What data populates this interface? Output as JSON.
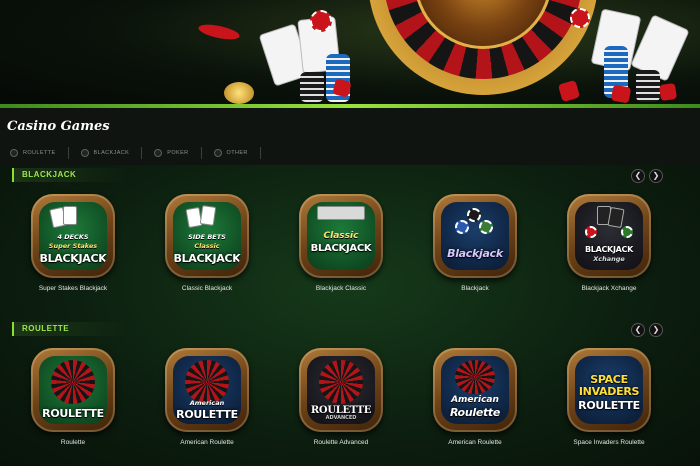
{
  "page": {
    "title": "Casino Games"
  },
  "filters": [
    {
      "label": "ROULETTE"
    },
    {
      "label": "BLACKJACK"
    },
    {
      "label": "POKER"
    },
    {
      "label": "OTHER"
    }
  ],
  "sections": [
    {
      "title": "BLACKJACK",
      "prev_icon": "chevron-left-icon",
      "next_icon": "chevron-right-icon",
      "games": [
        {
          "name": "Super Stakes Blackjack",
          "logo_top": "4 DECKS",
          "logo_mid": "Super Stakes",
          "logo_big": "BLACKJACK",
          "theme": "felt"
        },
        {
          "name": "Classic Blackjack",
          "logo_top": "SIDE BETS",
          "logo_mid": "Classic",
          "logo_big": "BLACKJACK",
          "theme": "felt"
        },
        {
          "name": "Blackjack Classic",
          "logo_top": "",
          "logo_mid": "Classic",
          "logo_big": "BLACKJACK",
          "theme": "felt"
        },
        {
          "name": "Blackjack",
          "logo_top": "",
          "logo_mid": "",
          "logo_big": "Blackjack",
          "theme": "blue"
        },
        {
          "name": "Blackjack Xchange",
          "logo_top": "",
          "logo_mid": "Xchange",
          "logo_big": "BLACKJACK",
          "theme": "dark"
        }
      ]
    },
    {
      "title": "ROULETTE",
      "prev_icon": "chevron-left-icon",
      "next_icon": "chevron-right-icon",
      "games": [
        {
          "name": "Roulette",
          "logo_top": "",
          "logo_mid": "",
          "logo_big": "ROULETTE",
          "theme": "felt"
        },
        {
          "name": "American Roulette",
          "logo_top": "",
          "logo_mid": "American",
          "logo_big": "ROULETTE",
          "theme": "blue"
        },
        {
          "name": "Roulette Advanced",
          "logo_top": "",
          "logo_mid": "ADVANCED",
          "logo_big": "ROULETTE",
          "theme": "dark"
        },
        {
          "name": "American Roulette",
          "logo_top": "",
          "logo_mid": "American",
          "logo_big": "Roulette",
          "theme": "blue"
        },
        {
          "name": "Space Invaders Roulette",
          "logo_top": "SPACE",
          "logo_mid": "INVADERS",
          "logo_big": "ROULETTE",
          "theme": "blue"
        }
      ]
    }
  ],
  "colors": {
    "accent": "#8be02b",
    "background": "#0b130c",
    "header": "#101411",
    "tile_frame": "#7a4a1a"
  }
}
